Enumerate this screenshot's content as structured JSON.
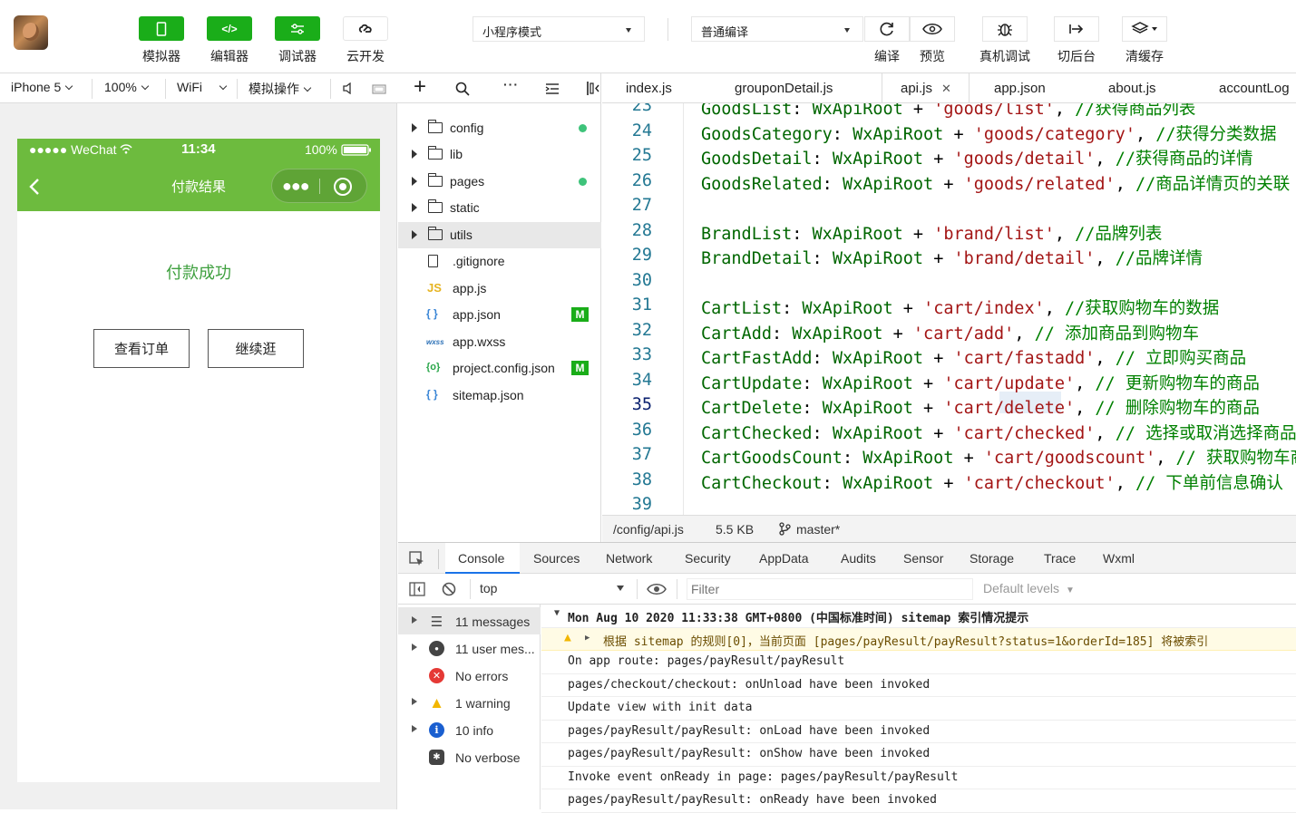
{
  "toolbar": {
    "buttons": [
      {
        "label": "模拟器",
        "icon": "phone-icon"
      },
      {
        "label": "编辑器",
        "icon": "code-icon"
      },
      {
        "label": "调试器",
        "icon": "debug-icon"
      },
      {
        "label": "云开发",
        "icon": "cloud-icon"
      }
    ],
    "mode_select": "小程序模式",
    "compile_select": "普通编译",
    "actions": [
      {
        "label": "编译",
        "icon": "refresh-icon"
      },
      {
        "label": "预览",
        "icon": "eye-icon"
      },
      {
        "label": "真机调试",
        "icon": "bug-icon"
      },
      {
        "label": "切后台",
        "icon": "switch-icon"
      },
      {
        "label": "清缓存",
        "icon": "layers-icon"
      }
    ]
  },
  "device_bar": {
    "device": "iPhone 5",
    "zoom": "100%",
    "network": "WiFi",
    "simulate": "模拟操作"
  },
  "phone": {
    "carrier": "●●●●● WeChat",
    "time": "11:34",
    "battery": "100%",
    "page_title": "付款结果",
    "result_text": "付款成功",
    "btn_view_order": "查看订单",
    "btn_continue": "继续逛"
  },
  "file_tree": [
    {
      "name": "config",
      "type": "folder",
      "badge": "dot"
    },
    {
      "name": "lib",
      "type": "folder",
      "badge": ""
    },
    {
      "name": "pages",
      "type": "folder",
      "badge": "dot"
    },
    {
      "name": "static",
      "type": "folder",
      "badge": ""
    },
    {
      "name": "utils",
      "type": "folder",
      "badge": "",
      "selected": true
    },
    {
      "name": ".gitignore",
      "type": "file",
      "icon": ""
    },
    {
      "name": "app.js",
      "type": "file",
      "icon": "JS"
    },
    {
      "name": "app.json",
      "type": "file",
      "icon": "{ }",
      "badge": "M"
    },
    {
      "name": "app.wxss",
      "type": "file",
      "icon": "wxss"
    },
    {
      "name": "project.config.json",
      "type": "file",
      "icon": "{o}",
      "badge": "M"
    },
    {
      "name": "sitemap.json",
      "type": "file",
      "icon": "{ }"
    }
  ],
  "editor_tabs": [
    "index.js",
    "grouponDetail.js",
    "api.js",
    "app.json",
    "about.js",
    "accountLog"
  ],
  "active_tab": "api.js",
  "code_lines": [
    {
      "n": "23",
      "key": "GoodsList",
      "path": "'goods/list'",
      "comment": "//获得商品列表"
    },
    {
      "n": "24",
      "key": "GoodsCategory",
      "path": "'goods/category'",
      "comment": "//获得分类数据"
    },
    {
      "n": "25",
      "key": "GoodsDetail",
      "path": "'goods/detail'",
      "comment": "//获得商品的详情"
    },
    {
      "n": "26",
      "key": "GoodsRelated",
      "path": "'goods/related'",
      "comment": "//商品详情页的关联"
    },
    {
      "n": "27",
      "key": "",
      "path": "",
      "comment": ""
    },
    {
      "n": "28",
      "key": "BrandList",
      "path": "'brand/list'",
      "comment": "//品牌列表"
    },
    {
      "n": "29",
      "key": "BrandDetail",
      "path": "'brand/detail'",
      "comment": "//品牌详情"
    },
    {
      "n": "30",
      "key": "",
      "path": "",
      "comment": ""
    },
    {
      "n": "31",
      "key": "CartList",
      "path": "'cart/index'",
      "comment": "//获取购物车的数据"
    },
    {
      "n": "32",
      "key": "CartAdd",
      "path": "'cart/add'",
      "comment": "// 添加商品到购物车"
    },
    {
      "n": "33",
      "key": "CartFastAdd",
      "path": "'cart/fastadd'",
      "comment": "// 立即购买商品"
    },
    {
      "n": "34",
      "key": "CartUpdate",
      "path": "'cart/update'",
      "comment": "// 更新购物车的商品"
    },
    {
      "n": "35",
      "key": "CartDelete",
      "path": "'cart/delete'",
      "comment": "// 删除购物车的商品"
    },
    {
      "n": "36",
      "key": "CartChecked",
      "path": "'cart/checked'",
      "comment": "// 选择或取消选择商品"
    },
    {
      "n": "37",
      "key": "CartGoodsCount",
      "path": "'cart/goodscount'",
      "comment": "// 获取购物车商"
    },
    {
      "n": "38",
      "key": "CartCheckout",
      "path": "'cart/checkout'",
      "comment": "// 下单前信息确认"
    },
    {
      "n": "39",
      "key": "",
      "path": "",
      "comment": ""
    }
  ],
  "code_root": "WxApiRoot",
  "editor_status": {
    "path": "/config/api.js",
    "size": "5.5 KB",
    "branch": "master*"
  },
  "devtools_tabs": [
    "Console",
    "Sources",
    "Network",
    "Security",
    "AppData",
    "Audits",
    "Sensor",
    "Storage",
    "Trace",
    "Wxml"
  ],
  "console_toolbar": {
    "context": "top",
    "filter_placeholder": "Filter",
    "levels": "Default levels"
  },
  "console_sidebar": [
    {
      "label": "11 messages",
      "icon": "list-icon",
      "arrow": true
    },
    {
      "label": "11 user mes...",
      "icon": "user-icon",
      "arrow": true
    },
    {
      "label": "No errors",
      "icon": "error-icon",
      "arrow": false
    },
    {
      "label": "1 warning",
      "icon": "warning-icon",
      "arrow": true
    },
    {
      "label": "10 info",
      "icon": "info-icon",
      "arrow": true
    },
    {
      "label": "No verbose",
      "icon": "verbose-icon",
      "arrow": false
    }
  ],
  "console_log": [
    "Mon Aug 10 2020 11:33:38 GMT+0800 (中国标准时间) sitemap 索引情况提示",
    "根据 sitemap 的规则[0]，当前页面 [pages/payResult/payResult?status=1&orderId=185] 将被索引",
    "On app route: pages/payResult/payResult",
    "pages/checkout/checkout: onUnload have been invoked",
    "Update view with init data",
    "pages/payResult/payResult: onLoad have been invoked",
    "pages/payResult/payResult: onShow have been invoked",
    "Invoke event onReady in page: pages/payResult/payResult",
    "pages/payResult/payResult: onReady have been invoked"
  ],
  "colors": {
    "brand_green": "#1aad19",
    "nav_green": "#6dbb3e",
    "success_text": "#3fa03f"
  }
}
